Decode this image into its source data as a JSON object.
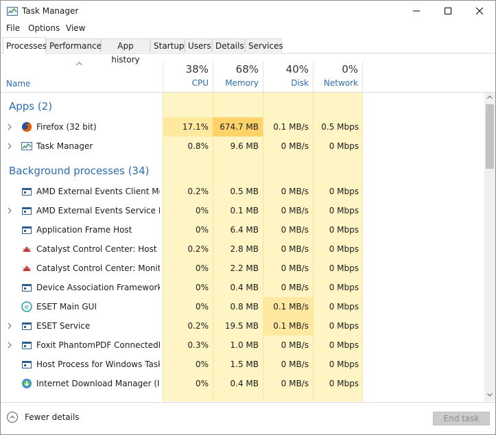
{
  "window": {
    "title": "Task Manager"
  },
  "menu": [
    "File",
    "Options",
    "View"
  ],
  "tabs": [
    "Processes",
    "Performance",
    "App history",
    "Startup",
    "Users",
    "Details",
    "Services"
  ],
  "header": {
    "name": "Name",
    "cpu": {
      "pct": "38%",
      "label": "CPU"
    },
    "memory": {
      "pct": "68%",
      "label": "Memory"
    },
    "disk": {
      "pct": "40%",
      "label": "Disk"
    },
    "network": {
      "pct": "0%",
      "label": "Network"
    }
  },
  "groups": {
    "apps": "Apps (2)",
    "background": "Background processes (34)"
  },
  "apps": [
    {
      "name": "Firefox (32 bit)",
      "cpu": "17.1%",
      "mem": "674.7 MB",
      "disk": "0.1 MB/s",
      "net": "0.5 Mbps",
      "icon": "firefox-icon"
    },
    {
      "name": "Task Manager",
      "cpu": "0.8%",
      "mem": "9.6 MB",
      "disk": "0 MB/s",
      "net": "0 Mbps",
      "icon": "task-manager-icon"
    }
  ],
  "background": [
    {
      "name": "AMD External Events Client Mo...",
      "cpu": "0.2%",
      "mem": "0.5 MB",
      "disk": "0 MB/s",
      "net": "0 Mbps",
      "icon": "service-window-icon"
    },
    {
      "name": "AMD External Events Service M...",
      "cpu": "0%",
      "mem": "0.1 MB",
      "disk": "0 MB/s",
      "net": "0 Mbps",
      "icon": "service-window-icon"
    },
    {
      "name": "Application Frame Host",
      "cpu": "0%",
      "mem": "6.4 MB",
      "disk": "0 MB/s",
      "net": "0 Mbps",
      "icon": "service-window-icon"
    },
    {
      "name": "Catalyst Control Center: Host a...",
      "cpu": "0.2%",
      "mem": "2.8 MB",
      "disk": "0 MB/s",
      "net": "0 Mbps",
      "icon": "catalyst-icon"
    },
    {
      "name": "Catalyst Control Center: Monito...",
      "cpu": "0%",
      "mem": "2.2 MB",
      "disk": "0 MB/s",
      "net": "0 Mbps",
      "icon": "catalyst-icon"
    },
    {
      "name": "Device Association Framework ...",
      "cpu": "0%",
      "mem": "0.4 MB",
      "disk": "0 MB/s",
      "net": "0 Mbps",
      "icon": "service-window-icon"
    },
    {
      "name": "ESET Main GUI",
      "cpu": "0%",
      "mem": "0.8 MB",
      "disk": "0.1 MB/s",
      "net": "0 Mbps",
      "icon": "eset-icon"
    },
    {
      "name": "ESET Service",
      "cpu": "0.2%",
      "mem": "19.5 MB",
      "disk": "0.1 MB/s",
      "net": "0 Mbps",
      "icon": "service-window-icon"
    },
    {
      "name": "Foxit PhantomPDF ConnectedP...",
      "cpu": "0.3%",
      "mem": "1.0 MB",
      "disk": "0 MB/s",
      "net": "0 Mbps",
      "icon": "service-window-icon"
    },
    {
      "name": "Host Process for Windows Tasks",
      "cpu": "0%",
      "mem": "1.5 MB",
      "disk": "0 MB/s",
      "net": "0 Mbps",
      "icon": "service-window-icon"
    },
    {
      "name": "Internet Download Manager (ID...",
      "cpu": "0%",
      "mem": "0.4 MB",
      "disk": "0 MB/s",
      "net": "0 Mbps",
      "icon": "idm-icon"
    }
  ],
  "footer": {
    "fewer": "Fewer details",
    "end_task": "End task"
  },
  "colors": {
    "accent": "#2b6cb0",
    "column_bg": "#fff4c4",
    "highlight": "#ffd26a"
  }
}
